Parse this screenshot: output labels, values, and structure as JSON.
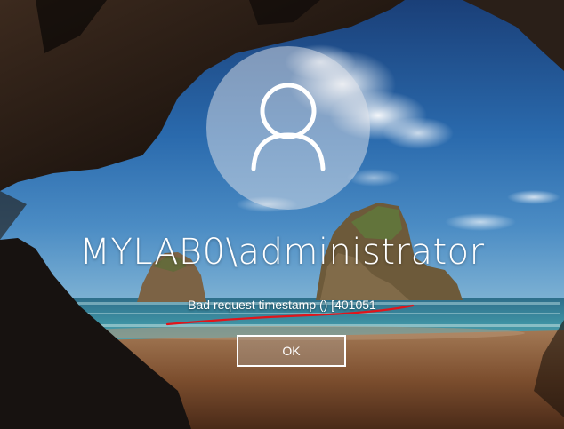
{
  "login": {
    "username": "MYLAB0\\administrator",
    "error_message": "Bad request timestamp () [401051",
    "ok_label": "OK"
  },
  "avatar": {
    "icon": "user-silhouette-icon"
  },
  "colors": {
    "text": "#ffffff",
    "annotation_underline": "#e0151b",
    "sky": "#1f5fa0",
    "sea": "#3c8ea0",
    "sand": "#8a5a36",
    "cave_rock": "#16110e"
  }
}
